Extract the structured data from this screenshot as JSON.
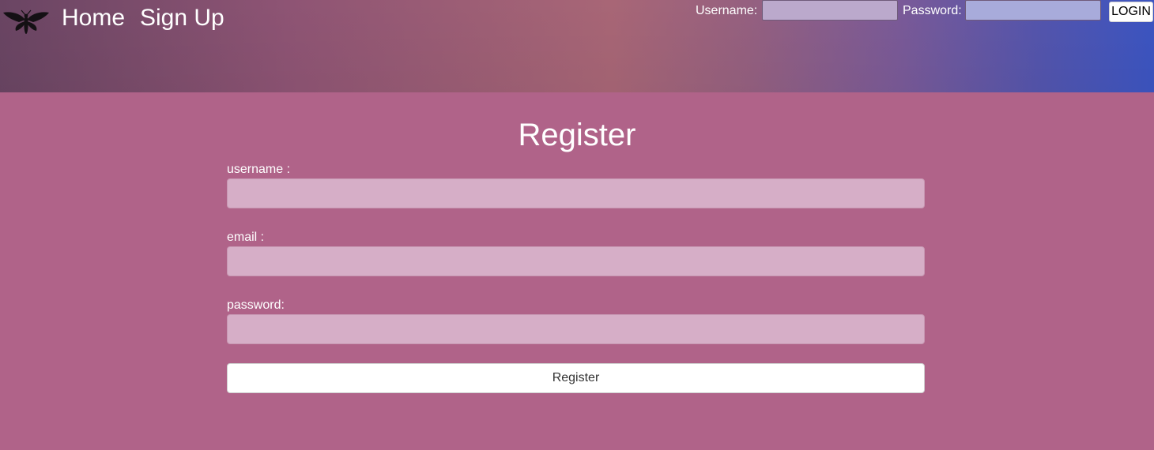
{
  "colors": {
    "page_background": "#b06389",
    "header_gradient_start": "#6a4563",
    "header_gradient_end": "#3c55c2",
    "field_background": "#d6aec7",
    "button_background": "#ffffff"
  },
  "header": {
    "logo_icon": "moth-icon",
    "nav": {
      "home": "Home",
      "signup": "Sign Up"
    },
    "login": {
      "username_label": "Username:",
      "username_value": "",
      "password_label": "Password:",
      "password_value": "",
      "button_label": "LOGIN"
    }
  },
  "form": {
    "title": "Register",
    "username_label": "username :",
    "username_value": "",
    "email_label": "email :",
    "email_value": "",
    "password_label": "password:",
    "password_value": "",
    "submit_label": "Register"
  }
}
